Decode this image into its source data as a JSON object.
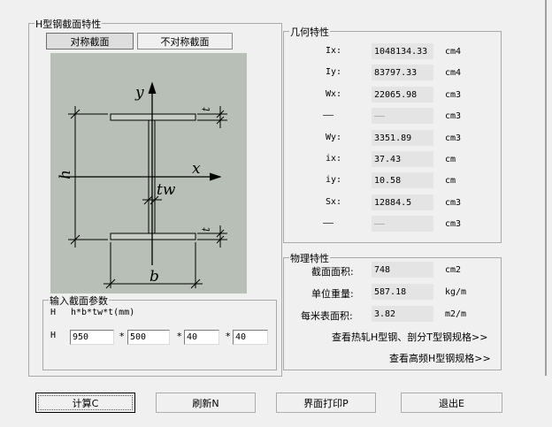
{
  "section_title": "H型钢截面特性",
  "toggle": {
    "symmetric": "对称截面",
    "asymmetric": "不对称截面"
  },
  "diagram": {
    "y": "y",
    "x": "x",
    "tw": "tw",
    "t_top": "t",
    "t_bottom": "t",
    "h": "h",
    "b": "b"
  },
  "geometry": {
    "title": "几何特性",
    "rows": [
      {
        "label": "Ix:",
        "value": "1048134.33",
        "unit": "cm4"
      },
      {
        "label": "Iy:",
        "value": "83797.33",
        "unit": "cm4"
      },
      {
        "label": "Wx:",
        "value": "22065.98",
        "unit": "cm3"
      },
      {
        "label": "——",
        "value": "——",
        "unit": "cm3"
      },
      {
        "label": "Wy:",
        "value": "3351.89",
        "unit": "cm3"
      },
      {
        "label": "ix:",
        "value": "37.43",
        "unit": "cm"
      },
      {
        "label": "iy:",
        "value": "10.58",
        "unit": "cm"
      },
      {
        "label": "Sx:",
        "value": "12884.5",
        "unit": "cm3"
      },
      {
        "label": "——",
        "value": "——",
        "unit": "cm3"
      }
    ]
  },
  "physical": {
    "title": "物理特性",
    "rows": [
      {
        "label": "截面面积:",
        "value": "748",
        "unit": "cm2"
      },
      {
        "label": "单位重量:",
        "value": "587.18",
        "unit": "kg/m"
      },
      {
        "label": "每米表面积:",
        "value": "3.82",
        "unit": "m2/m"
      }
    ],
    "link_hot": "查看热轧H型钢、剖分T型钢规格>>",
    "link_hf": "查看高频H型钢规格>>"
  },
  "input": {
    "title": "输入截面参数",
    "prefix1": "H",
    "formula": "h*b*tw*t(mm)",
    "prefix2": "H",
    "h": "950",
    "b": "500",
    "tw": "40",
    "t": "40",
    "star": "*"
  },
  "buttons": {
    "calc": "计算C",
    "refresh": "刷新N",
    "print": "界面打印P",
    "exit": "退出E"
  }
}
